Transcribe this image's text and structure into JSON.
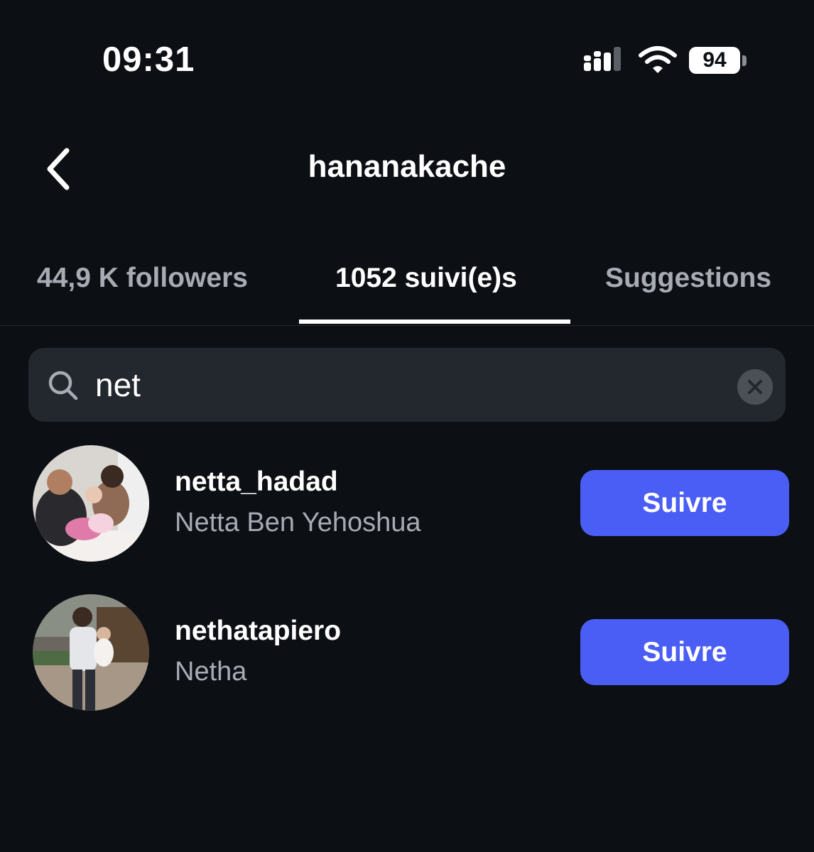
{
  "status_bar": {
    "time": "09:31",
    "battery_level": "94",
    "icons": [
      "signal-icon",
      "wifi-icon",
      "battery-icon"
    ]
  },
  "header": {
    "title": "hananakache",
    "back_icon": "chevron-left-icon"
  },
  "tabs": [
    {
      "label": "44,9 K followers",
      "active": false
    },
    {
      "label": "1052 suivi(e)s",
      "active": true
    },
    {
      "label": "Suggestions",
      "active": false
    }
  ],
  "search": {
    "value": "net",
    "icon": "search-icon",
    "clear_icon": "close-icon"
  },
  "results": [
    {
      "username": "netta_hadad",
      "name": "Netta Ben Yehoshua",
      "button": "Suivre"
    },
    {
      "username": "nethatapiero",
      "name": "Netha",
      "button": "Suivre"
    }
  ],
  "colors": {
    "background": "#0c0f14",
    "accent": "#4a5ef6",
    "secondary_text": "#a7abb3",
    "search_bg": "#23272e"
  }
}
